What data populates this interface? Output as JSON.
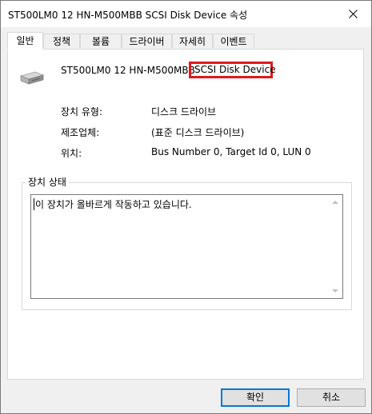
{
  "window": {
    "title": "ST500LM0 12 HN-M500MBB SCSI Disk Device 속성"
  },
  "tabs": [
    {
      "label": "일반",
      "active": true
    },
    {
      "label": "정책",
      "active": false
    },
    {
      "label": "볼륨",
      "active": false
    },
    {
      "label": "드라이버",
      "active": false
    },
    {
      "label": "자세히",
      "active": false
    },
    {
      "label": "이벤트",
      "active": false
    }
  ],
  "device": {
    "icon": "disk-drive-icon",
    "name_prefix": "ST500LM0 12 HN-M500MBB",
    "name_highlight": "SCSI Disk Device",
    "highlight_color": "#e1191d"
  },
  "properties": [
    {
      "label": "장치 유형:",
      "value": "디스크 드라이브"
    },
    {
      "label": "제조업체:",
      "value": "(표준 디스크 드라이브)"
    },
    {
      "label": "위치:",
      "value": "Bus Number 0, Target Id 0, LUN 0"
    }
  ],
  "status": {
    "group_title": "장치 상태",
    "text": "이 장치가 올바르게 작동하고 있습니다."
  },
  "buttons": {
    "ok": "확인",
    "cancel": "취소"
  },
  "colors": {
    "accent": "#0078d7",
    "dialog_bg": "#f0f0f0",
    "panel_bg": "#ffffff"
  }
}
